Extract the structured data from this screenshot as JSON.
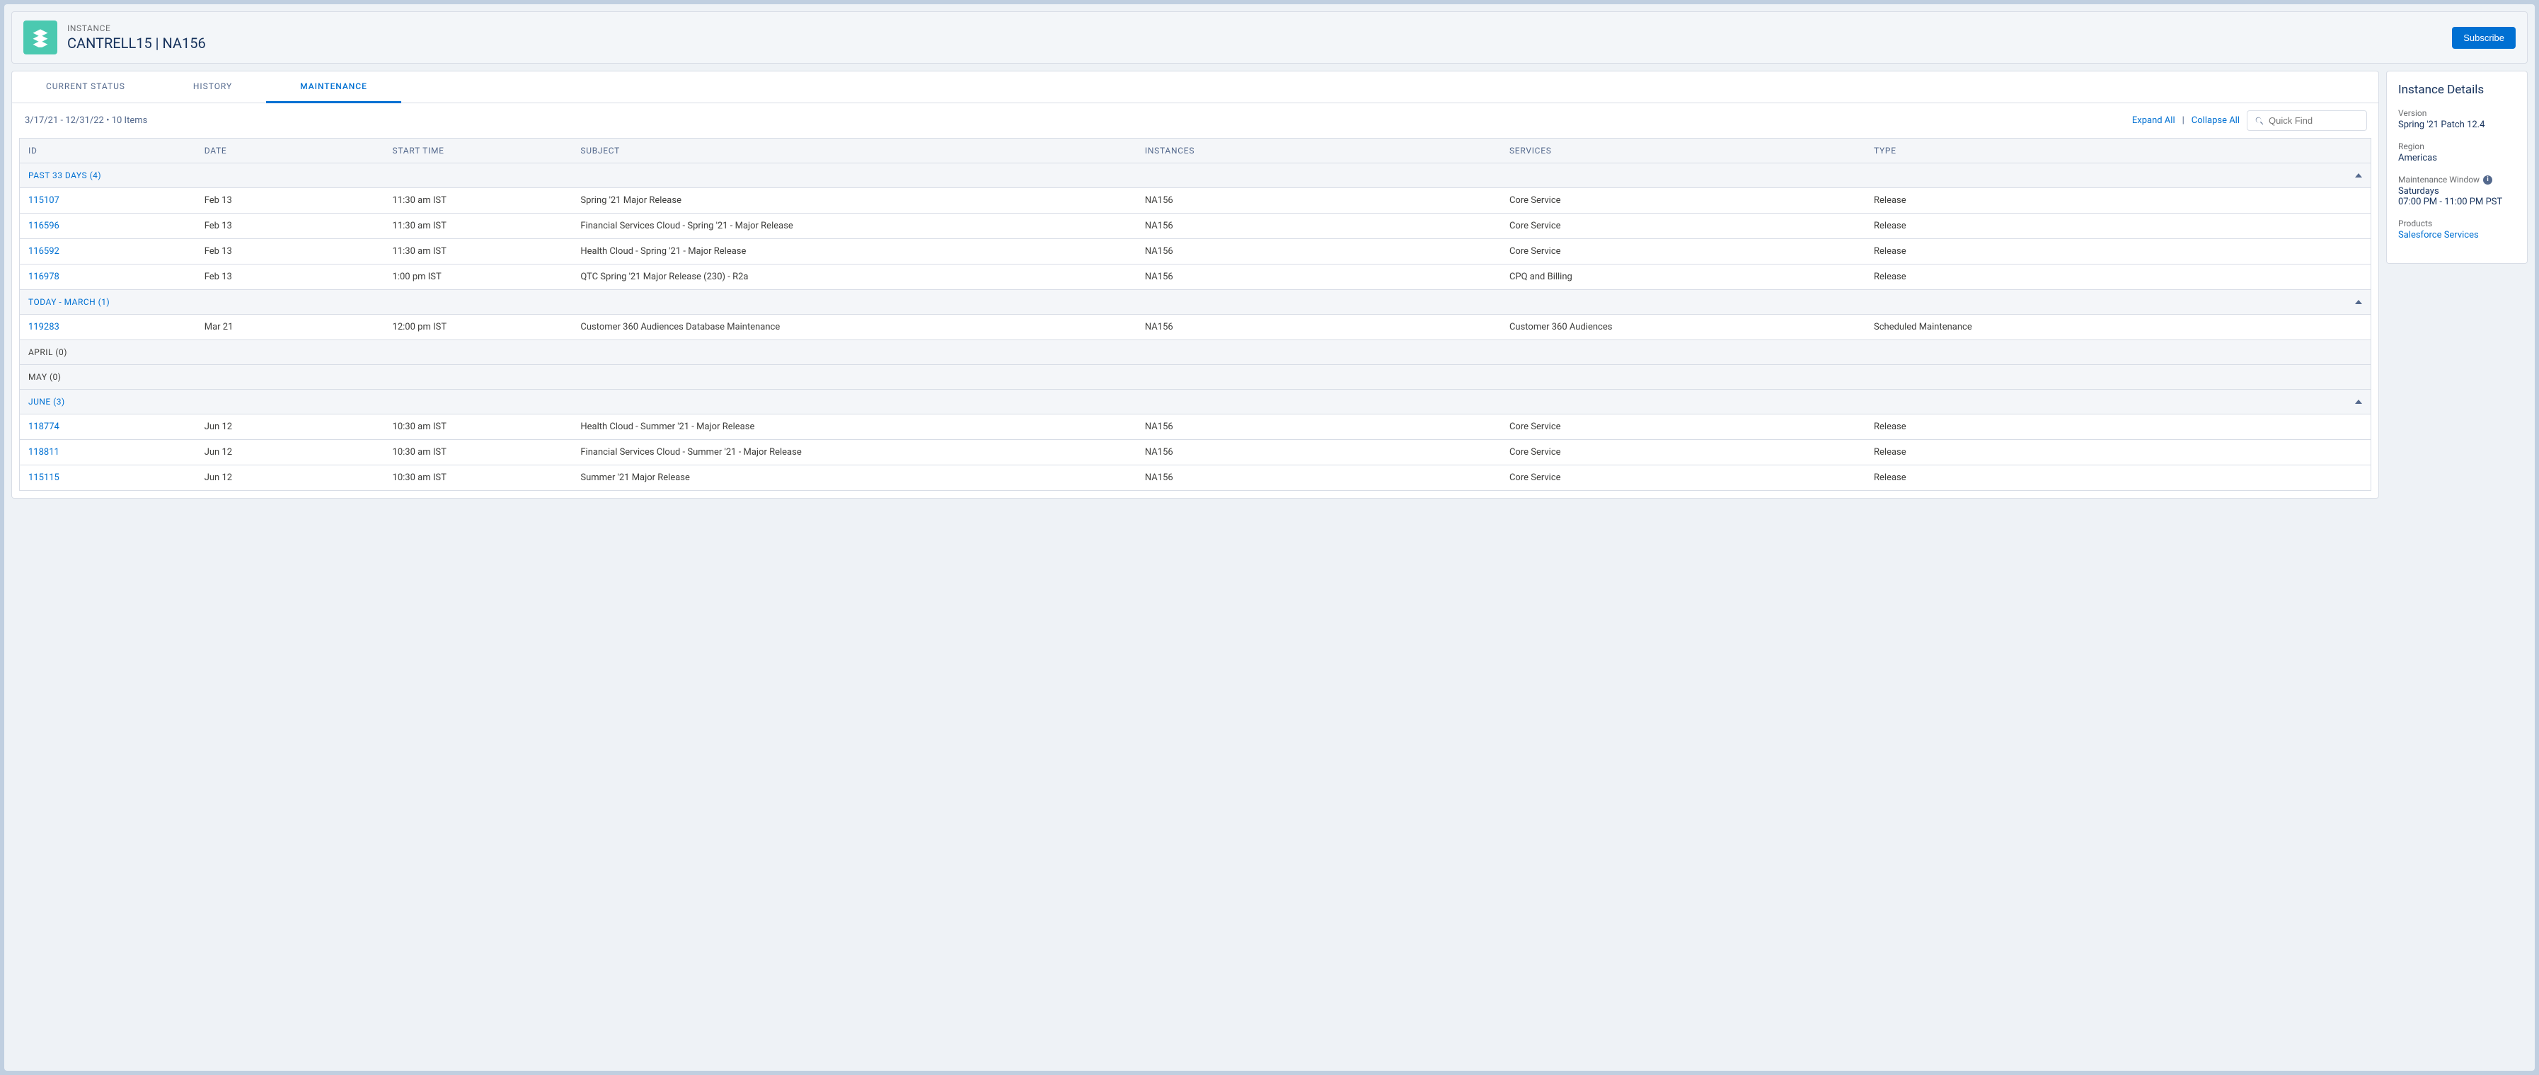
{
  "header": {
    "eyebrow": "INSTANCE",
    "title": "CANTRELL15 | NA156",
    "subscribe_label": "Subscribe"
  },
  "tabs": {
    "current_status": "CURRENT STATUS",
    "history": "HISTORY",
    "maintenance": "MAINTENANCE"
  },
  "toolbar": {
    "range": "3/17/21 - 12/31/22 • 10 Items",
    "expand_all": "Expand All",
    "collapse_all": "Collapse All",
    "quick_find_placeholder": "Quick Find"
  },
  "columns": {
    "id": "ID",
    "date": "DATE",
    "start_time": "START TIME",
    "subject": "SUBJECT",
    "instances": "INSTANCES",
    "services": "SERVICES",
    "type": "TYPE"
  },
  "groups": {
    "past33": "PAST 33 DAYS (4)",
    "today_march": "TODAY - MARCH (1)",
    "april": "APRIL (0)",
    "may": "MAY (0)",
    "june": "JUNE (3)"
  },
  "rows": {
    "past": [
      {
        "id": "115107",
        "date": "Feb 13",
        "start": "11:30 am IST",
        "subject": "Spring '21 Major Release",
        "instances": "NA156",
        "services": "Core Service",
        "type": "Release"
      },
      {
        "id": "116596",
        "date": "Feb 13",
        "start": "11:30 am IST",
        "subject": "Financial Services Cloud - Spring '21 - Major Release",
        "instances": "NA156",
        "services": "Core Service",
        "type": "Release"
      },
      {
        "id": "116592",
        "date": "Feb 13",
        "start": "11:30 am IST",
        "subject": "Health Cloud - Spring '21 - Major Release",
        "instances": "NA156",
        "services": "Core Service",
        "type": "Release"
      },
      {
        "id": "116978",
        "date": "Feb 13",
        "start": "1:00 pm IST",
        "subject": "QTC Spring '21 Major Release (230) - R2a",
        "instances": "NA156",
        "services": "CPQ and Billing",
        "type": "Release"
      }
    ],
    "today_march": [
      {
        "id": "119283",
        "date": "Mar 21",
        "start": "12:00 pm IST",
        "subject": "Customer 360 Audiences Database Maintenance",
        "instances": "NA156",
        "services": "Customer 360 Audiences",
        "type": "Scheduled Maintenance"
      }
    ],
    "june": [
      {
        "id": "118774",
        "date": "Jun 12",
        "start": "10:30 am IST",
        "subject": "Health Cloud - Summer '21 - Major Release",
        "instances": "NA156",
        "services": "Core Service",
        "type": "Release"
      },
      {
        "id": "118811",
        "date": "Jun 12",
        "start": "10:30 am IST",
        "subject": "Financial Services Cloud - Summer '21 - Major Release",
        "instances": "NA156",
        "services": "Core Service",
        "type": "Release"
      },
      {
        "id": "115115",
        "date": "Jun 12",
        "start": "10:30 am IST",
        "subject": "Summer '21 Major Release",
        "instances": "NA156",
        "services": "Core Service",
        "type": "Release"
      }
    ]
  },
  "details": {
    "title": "Instance Details",
    "version_label": "Version",
    "version_value": "Spring '21 Patch 12.4",
    "region_label": "Region",
    "region_value": "Americas",
    "mw_label": "Maintenance Window",
    "mw_value_line1": "Saturdays",
    "mw_value_line2": "07:00 PM - 11:00 PM PST",
    "products_label": "Products",
    "products_value": "Salesforce Services"
  }
}
